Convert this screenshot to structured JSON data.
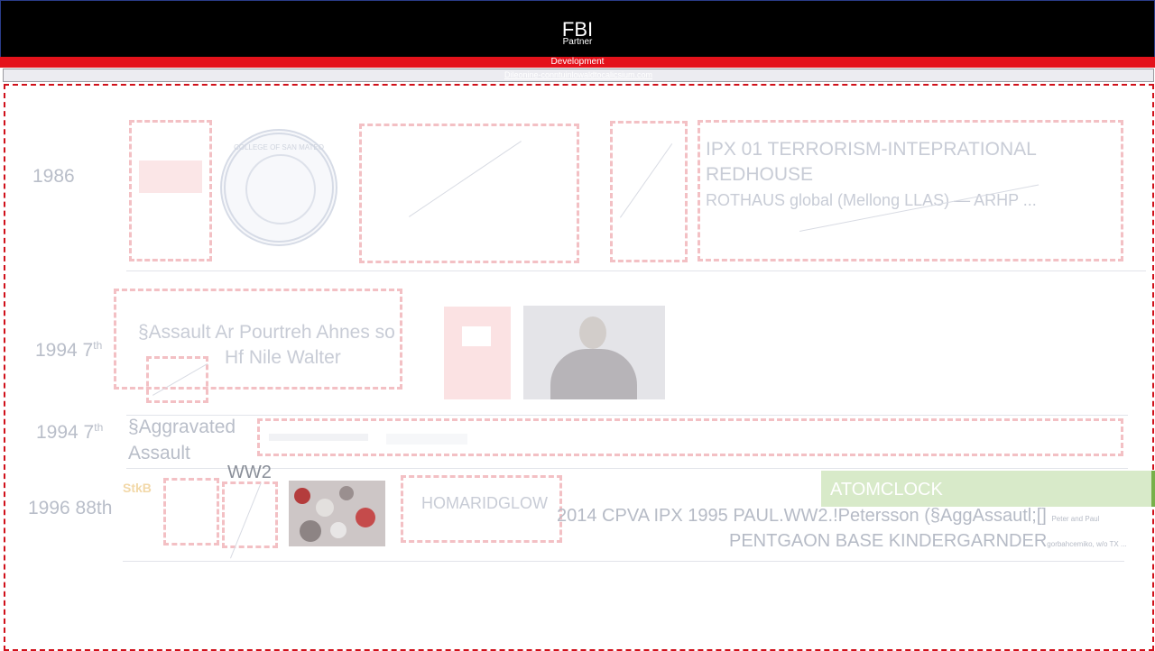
{
  "header": {
    "title": "FBI",
    "subtitle": "Partner"
  },
  "banner": {
    "label": "Development"
  },
  "link_bar": {
    "text": "Dileonine-conntuinlowaldtocalicsium.com"
  },
  "rows": [
    {
      "year": "1986",
      "sup": "",
      "title_lines": [
        "IPX 01 TERRORISM-INTEPRATIONAL",
        "REDHOUSE"
      ],
      "detail_line": "ROTHAUS global (Mellong LLAS) — ARHP ...",
      "seal_label": "COLLEGE OF SAN MATEO"
    },
    {
      "year": "1994 7",
      "sup": "th",
      "text_line1": "§Assault   Ar   Pourtreh Ahnes so",
      "text_line2": "Hf       Nile Walter"
    },
    {
      "year": "1994 7",
      "sup": "th",
      "label_line1": "§Aggravated",
      "label_line2": "Assault"
    },
    {
      "year": "1996 88th",
      "sup": "",
      "logo_text": "StkB",
      "ww2": "WW2",
      "box_text": "HOMARIDGLOW",
      "greenbar": "ATOMCLOCK",
      "line1": "2014 CPVA IPX 1995  PAUL.WW2.!Petersson (§AggAssautl;[]",
      "line1_small": "Peter and Paul",
      "line2": "PENTGAON BASE KINDERGARNDER",
      "line2_small": "gorbahcemiko, w/o TX ..."
    }
  ],
  "colors": {
    "header": "#000000",
    "banner": "#e4121b",
    "frame": "#d0101a"
  }
}
